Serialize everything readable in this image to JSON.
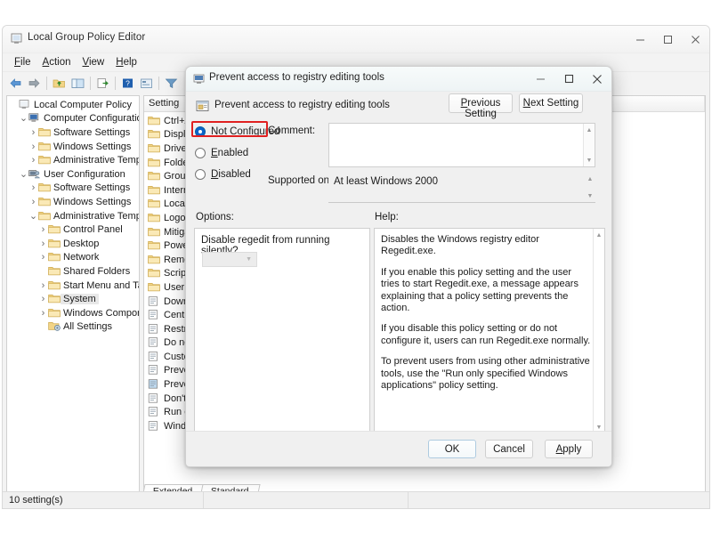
{
  "main_window": {
    "title": "Local Group Policy Editor",
    "menu": [
      "File",
      "Action",
      "View",
      "Help"
    ],
    "toolbar_icons": [
      "back-arrow-icon",
      "forward-arrow-icon",
      "up-folder-icon",
      "show-hide-tree-icon",
      "export-list-icon",
      "help-icon",
      "properties-icon",
      "filter-icon"
    ],
    "window_controls": [
      "minimize-icon",
      "maximize-icon",
      "close-icon"
    ],
    "status_text": "10 setting(s)",
    "tabs": [
      "Extended",
      "Standard"
    ],
    "column_header": "Setting"
  },
  "tree": {
    "root": "Local Computer Policy",
    "items": [
      {
        "label": "Local Computer Policy",
        "indent": 0,
        "chev": "",
        "icon": "policy-icon",
        "selected": false
      },
      {
        "label": "Computer Configuration",
        "indent": 1,
        "chev": "v",
        "icon": "computer-icon",
        "selected": false
      },
      {
        "label": "Software Settings",
        "indent": 2,
        "chev": ">",
        "icon": "folder-icon",
        "selected": false
      },
      {
        "label": "Windows Settings",
        "indent": 2,
        "chev": ">",
        "icon": "folder-icon",
        "selected": false
      },
      {
        "label": "Administrative Templates",
        "indent": 2,
        "chev": ">",
        "icon": "folder-icon",
        "selected": false
      },
      {
        "label": "User Configuration",
        "indent": 1,
        "chev": "v",
        "icon": "user-icon",
        "selected": false
      },
      {
        "label": "Software Settings",
        "indent": 2,
        "chev": ">",
        "icon": "folder-icon",
        "selected": false
      },
      {
        "label": "Windows Settings",
        "indent": 2,
        "chev": ">",
        "icon": "folder-icon",
        "selected": false
      },
      {
        "label": "Administrative Templates",
        "indent": 2,
        "chev": "v",
        "icon": "folder-icon",
        "selected": false
      },
      {
        "label": "Control Panel",
        "indent": 3,
        "chev": ">",
        "icon": "folder-icon",
        "selected": false
      },
      {
        "label": "Desktop",
        "indent": 3,
        "chev": ">",
        "icon": "folder-icon",
        "selected": false
      },
      {
        "label": "Network",
        "indent": 3,
        "chev": ">",
        "icon": "folder-icon",
        "selected": false
      },
      {
        "label": "Shared Folders",
        "indent": 3,
        "chev": "",
        "icon": "folder-icon",
        "selected": false
      },
      {
        "label": "Start Menu and Taskbar",
        "indent": 3,
        "chev": ">",
        "icon": "folder-icon",
        "selected": false
      },
      {
        "label": "System",
        "indent": 3,
        "chev": ">",
        "icon": "folder-icon",
        "selected": true
      },
      {
        "label": "Windows Components",
        "indent": 3,
        "chev": ">",
        "icon": "folder-icon",
        "selected": false
      },
      {
        "label": "All Settings",
        "indent": 3,
        "chev": "",
        "icon": "all-settings-icon",
        "selected": false
      }
    ]
  },
  "settings_list": [
    {
      "label": "Ctrl+Alt+Del Options",
      "type": "folder",
      "selected": false
    },
    {
      "label": "Display",
      "type": "folder",
      "selected": false
    },
    {
      "label": "Driver Installation",
      "type": "folder",
      "selected": false
    },
    {
      "label": "Folder Redirection",
      "type": "folder",
      "selected": false
    },
    {
      "label": "Group Policy",
      "type": "folder",
      "selected": false
    },
    {
      "label": "Internet Communication Management",
      "type": "folder",
      "selected": false
    },
    {
      "label": "Locale Services",
      "type": "folder",
      "selected": false
    },
    {
      "label": "Logon",
      "type": "folder",
      "selected": false
    },
    {
      "label": "Mitigation Options",
      "type": "folder",
      "selected": false
    },
    {
      "label": "Power Management",
      "type": "folder",
      "selected": false
    },
    {
      "label": "Removable Storage Access",
      "type": "folder",
      "selected": false
    },
    {
      "label": "Scripts",
      "type": "folder",
      "selected": false
    },
    {
      "label": "User Profiles",
      "type": "folder",
      "selected": false
    },
    {
      "label": "Download missing COM components",
      "type": "setting",
      "selected": false
    },
    {
      "label": "Century interpretation for Year 2000",
      "type": "setting",
      "selected": false
    },
    {
      "label": "Restrict these programs from being launched from Help",
      "type": "setting",
      "selected": false
    },
    {
      "label": "Do not display the Getting Started welcome screen at logon",
      "type": "setting",
      "selected": false
    },
    {
      "label": "Custom User Interface",
      "type": "setting",
      "selected": false
    },
    {
      "label": "Prevent access to the command prompt",
      "type": "setting",
      "selected": false
    },
    {
      "label": "Prevent access to registry editing tools",
      "type": "setting",
      "selected": true
    },
    {
      "label": "Don't run specified Windows applications",
      "type": "setting",
      "selected": false
    },
    {
      "label": "Run only specified Windows applications",
      "type": "setting",
      "selected": false
    },
    {
      "label": "Windows Automatic Updates",
      "type": "setting",
      "selected": false
    }
  ],
  "dialog": {
    "title": "Prevent access to registry editing tools",
    "header_title": "Prevent access to registry editing tools",
    "window_controls": [
      "minimize-icon",
      "maximize-icon",
      "close-icon"
    ],
    "previous_setting": "Previous Setting",
    "next_setting": "Next Setting",
    "radios": [
      {
        "label": "Not Configured",
        "accesskey": "C",
        "selected": true
      },
      {
        "label": "Enabled",
        "accesskey": "E",
        "selected": false
      },
      {
        "label": "Disabled",
        "accesskey": "D",
        "selected": false
      }
    ],
    "comment_label": "Comment:",
    "comment_value": "",
    "supported_label": "Supported on:",
    "supported_value": "At least Windows 2000",
    "options_label": "Options:",
    "options_question": "Disable regedit from running silently?",
    "options_combo_value": "",
    "help_label": "Help:",
    "help_paragraphs": [
      "Disables the Windows registry editor Regedit.exe.",
      "If you enable this policy setting and the user tries to start Regedit.exe, a message appears explaining that a policy setting prevents the action.",
      "If you disable this policy setting or do not configure it, users can run Regedit.exe normally.",
      "To prevent users from using other administrative tools, use the \"Run only specified Windows applications\" policy setting."
    ],
    "buttons": {
      "ok": "OK",
      "cancel": "Cancel",
      "apply": "Apply"
    }
  },
  "colors": {
    "highlight_red": "#e02020",
    "radio_blue": "#0a63c9",
    "folder_yellow": "#f5d67e",
    "window_bg": "#f0f0f0"
  }
}
